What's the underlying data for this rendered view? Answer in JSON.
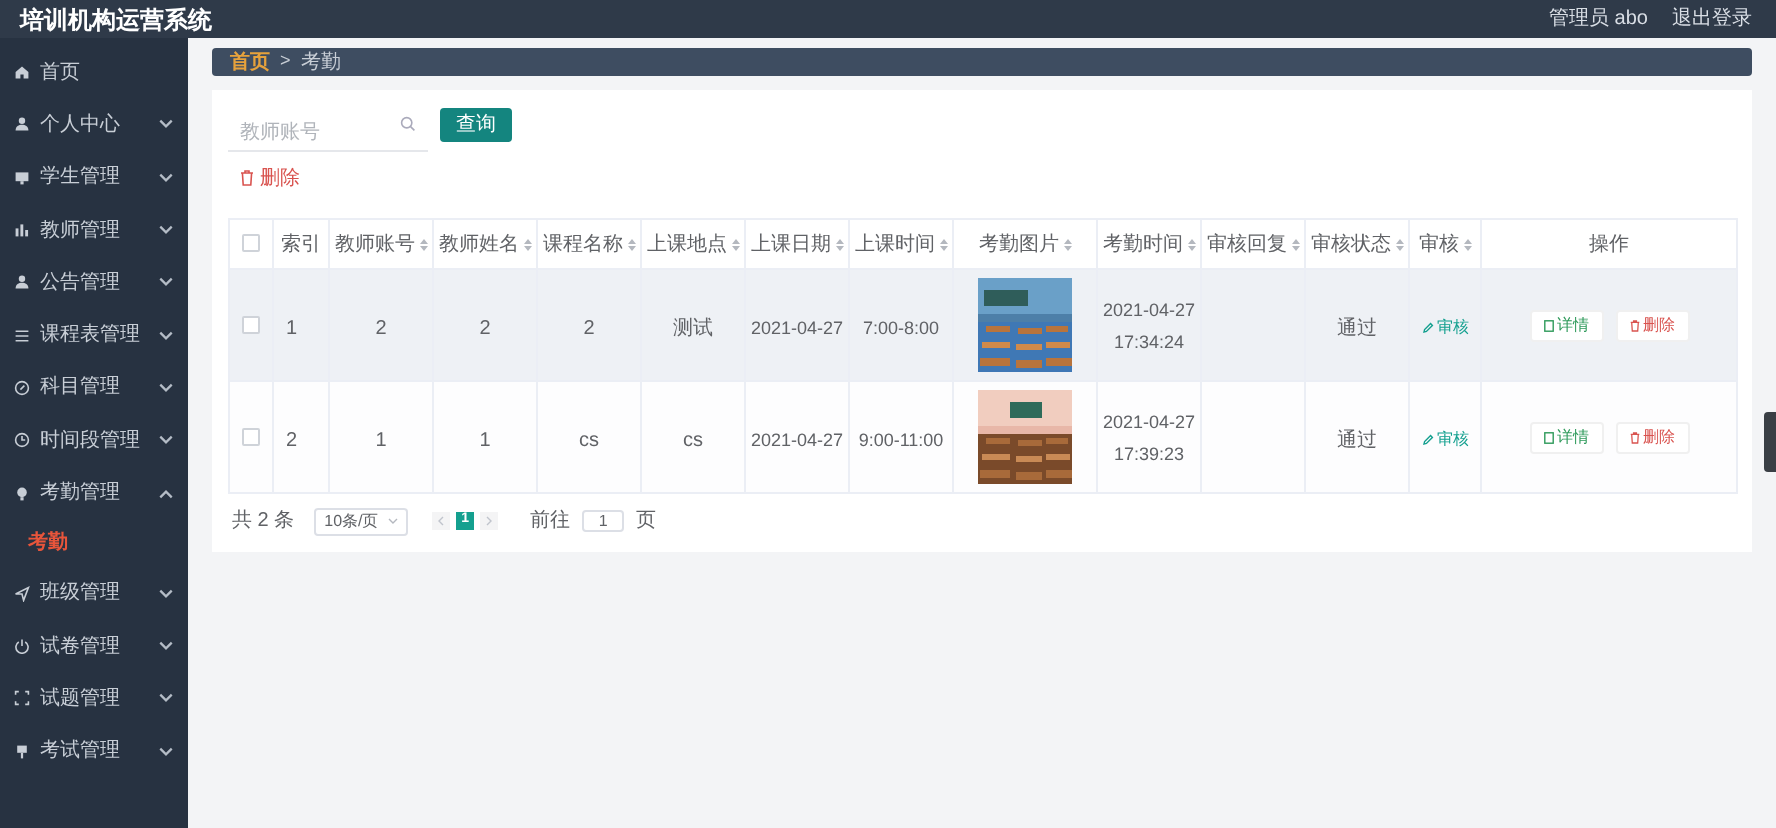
{
  "app_title": "培训机构运营系统",
  "header": {
    "user": "管理员 abo",
    "logout": "退出登录"
  },
  "sidebar": {
    "items": [
      {
        "label": "首页",
        "kind": "link"
      },
      {
        "label": "个人中心",
        "kind": "menu",
        "expanded": false
      },
      {
        "label": "学生管理",
        "kind": "menu",
        "expanded": false
      },
      {
        "label": "教师管理",
        "kind": "menu",
        "expanded": false
      },
      {
        "label": "公告管理",
        "kind": "menu",
        "expanded": false
      },
      {
        "label": "课程表管理",
        "kind": "menu",
        "expanded": false
      },
      {
        "label": "科目管理",
        "kind": "menu",
        "expanded": false
      },
      {
        "label": "时间段管理",
        "kind": "menu",
        "expanded": false
      },
      {
        "label": "考勤管理",
        "kind": "menu",
        "expanded": true,
        "children": [
          {
            "label": "考勤",
            "selected": true
          }
        ]
      },
      {
        "label": "班级管理",
        "kind": "menu",
        "expanded": false
      },
      {
        "label": "试卷管理",
        "kind": "menu",
        "expanded": false
      },
      {
        "label": "试题管理",
        "kind": "menu",
        "expanded": false
      },
      {
        "label": "考试管理",
        "kind": "menu",
        "expanded": false
      }
    ]
  },
  "breadcrumb": {
    "items": [
      "首页",
      "考勤"
    ],
    "separator": ">"
  },
  "search": {
    "placeholder": "教师账号",
    "button": "查询"
  },
  "delete_button": "删除",
  "table": {
    "select_all_checked": false,
    "columns": [
      {
        "label": "索引",
        "sortable": false
      },
      {
        "label": "教师账号",
        "sortable": true
      },
      {
        "label": "教师姓名",
        "sortable": true
      },
      {
        "label": "课程名称",
        "sortable": true
      },
      {
        "label": "上课地点",
        "sortable": true
      },
      {
        "label": "上课日期",
        "sortable": true
      },
      {
        "label": "上课时间",
        "sortable": true
      },
      {
        "label": "考勤图片",
        "sortable": true
      },
      {
        "label": "考勤时间",
        "sortable": true
      },
      {
        "label": "审核回复",
        "sortable": true
      },
      {
        "label": "审核状态",
        "sortable": true
      },
      {
        "label": "审核",
        "sortable": true
      },
      {
        "label": "操作",
        "sortable": false
      }
    ],
    "rows": [
      {
        "checked": false,
        "highlighted": true,
        "index": "1",
        "teacher_account": "2",
        "teacher_name": "2",
        "course": "2",
        "location": "测试",
        "date": "2021-04-27",
        "time": "7:00-8:00",
        "checkin_date": "2021-04-27",
        "checkin_time": "17:34:24",
        "review_status": "通过",
        "review_link": "审核",
        "actions": [
          "详情",
          "删除"
        ]
      },
      {
        "checked": false,
        "highlighted": false,
        "index": "2",
        "teacher_account": "1",
        "teacher_name": "1",
        "course": "cs",
        "location": "cs",
        "date": "2021-04-27",
        "time": "9:00-11:00",
        "checkin_date": "2021-04-27",
        "checkin_time": "17:39:23",
        "review_status": "通过",
        "review_link": "审核",
        "actions": [
          "详情",
          "删除"
        ]
      }
    ]
  },
  "pagination": {
    "total": "共 2 条",
    "page_size": "10条/页",
    "pages": [
      {
        "label": "1",
        "selected": true
      }
    ],
    "goto_label": "前往",
    "goto_value": "1",
    "goto_suffix": "页"
  }
}
